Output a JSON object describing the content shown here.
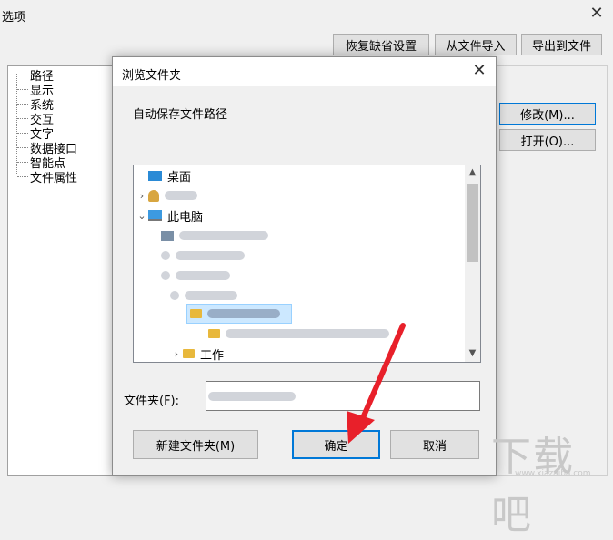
{
  "options_window": {
    "title": "选项",
    "close_glyph": "✕",
    "toolbar": {
      "restore_defaults": "恢复缺省设置",
      "import_from_file": "从文件导入",
      "export_to_file": "导出到文件"
    },
    "tree": [
      "路径",
      "显示",
      "系统",
      "交互",
      "文字",
      "数据接口",
      "智能点",
      "文件属性"
    ],
    "modify_button": "修改(M)...",
    "open_button": "打开(O)..."
  },
  "dialog": {
    "title": "浏览文件夹",
    "close_glyph": "✕",
    "description": "自动保存文件路径",
    "tree": {
      "desktop": "桌面",
      "this_pc": "此电脑",
      "partial_last": "工作"
    },
    "folder_label": "文件夹(F):",
    "folder_value": "",
    "new_folder_button": "新建文件夹(M)",
    "ok_button": "确定",
    "cancel_button": "取消",
    "icons": [
      "desktop-icon",
      "user-folder-icon",
      "computer-icon",
      "network-drive-icon",
      "folder-icon"
    ]
  },
  "watermark": {
    "main": "下载吧",
    "sub": "www.xiazaiba.com"
  },
  "colors": {
    "accent": "#0078d7",
    "arrow": "#e8202a",
    "selection": "#cce8ff"
  }
}
